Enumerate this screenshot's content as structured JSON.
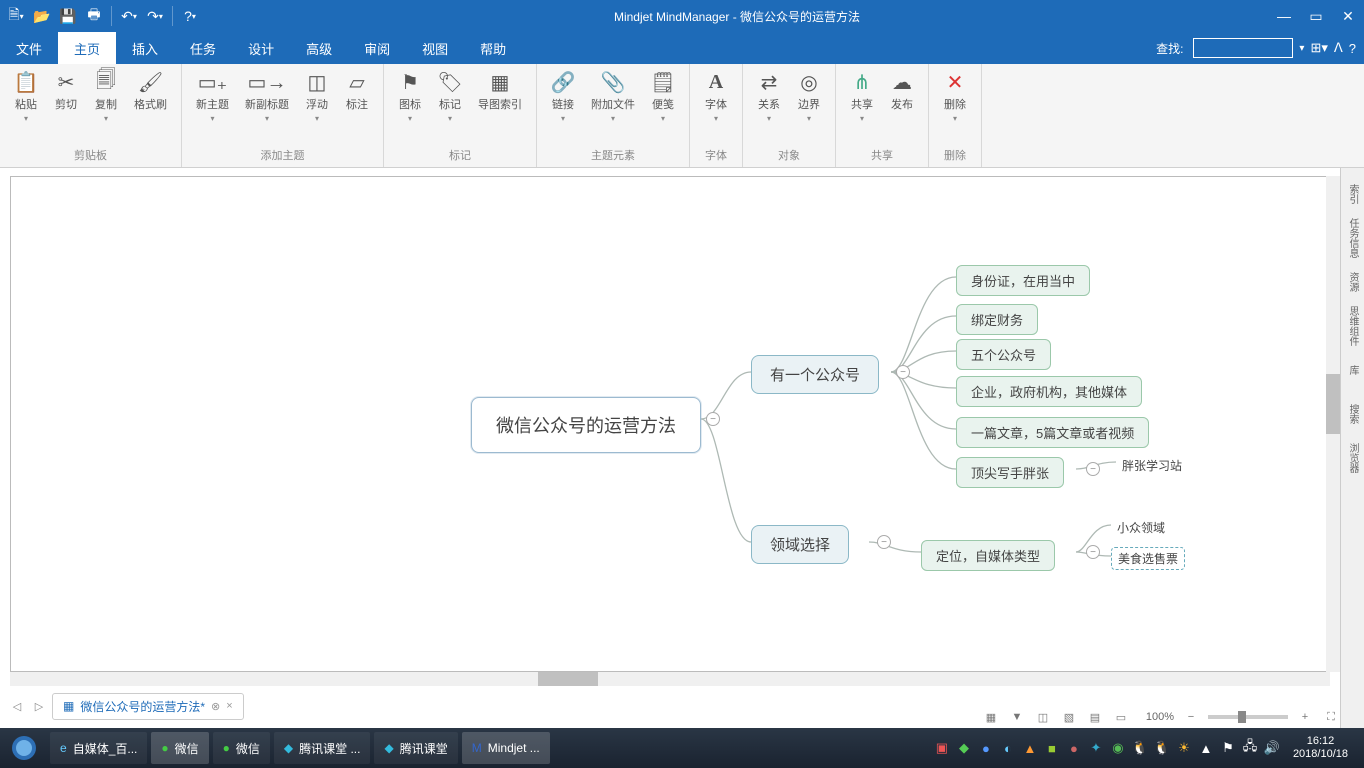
{
  "app": {
    "title": "Mindjet MindManager - 微信公众号的运营方法"
  },
  "qat": [
    "new",
    "open",
    "save",
    "print",
    "undo",
    "redo",
    "help"
  ],
  "menu": {
    "items": [
      "文件",
      "主页",
      "插入",
      "任务",
      "设计",
      "高级",
      "审阅",
      "视图",
      "帮助"
    ],
    "active": 1,
    "search_label": "查找:"
  },
  "ribbon": {
    "groups": [
      {
        "label": "剪贴板",
        "buttons": [
          "粘贴",
          "剪切",
          "复制",
          "格式刷"
        ]
      },
      {
        "label": "添加主题",
        "buttons": [
          "新主题",
          "新副标题",
          "浮动",
          "标注"
        ]
      },
      {
        "label": "标记",
        "buttons": [
          "图标",
          "标记",
          "导图索引"
        ]
      },
      {
        "label": "主题元素",
        "buttons": [
          "链接",
          "附加文件",
          "便笺"
        ]
      },
      {
        "label": "字体",
        "buttons": [
          "字体"
        ]
      },
      {
        "label": "对象",
        "buttons": [
          "关系",
          "边界"
        ]
      },
      {
        "label": "共享",
        "buttons": [
          "共享",
          "发布"
        ]
      },
      {
        "label": "删除",
        "buttons": [
          "删除"
        ]
      }
    ]
  },
  "mindmap": {
    "root": "微信公众号的运营方法",
    "branch1": {
      "title": "有一个公众号",
      "children": [
        "身份证，在用当中",
        "绑定财务",
        "五个公众号",
        "企业，政府机构，其他媒体",
        "一篇文章，5篇文章或者视频",
        "顶尖写手胖张"
      ],
      "sub_of_last": "胖张学习站"
    },
    "branch2": {
      "title": "领域选择",
      "child": "定位，自媒体类型",
      "sub1": "小众领域",
      "sub2": "美食选售票"
    }
  },
  "sidebar": [
    "索引",
    "任务信息",
    "资源",
    "思维组件",
    "库",
    "搜索",
    "浏览器"
  ],
  "doc_tab": {
    "name": "微信公众号的运营方法*"
  },
  "status": {
    "zoom": "100%"
  },
  "taskbar": {
    "items": [
      "自媒体_百...",
      "微信",
      "微信",
      "腾讯课堂 ...",
      "腾讯课堂",
      "Mindjet ..."
    ],
    "time": "16:12",
    "date": "2018/10/18"
  }
}
